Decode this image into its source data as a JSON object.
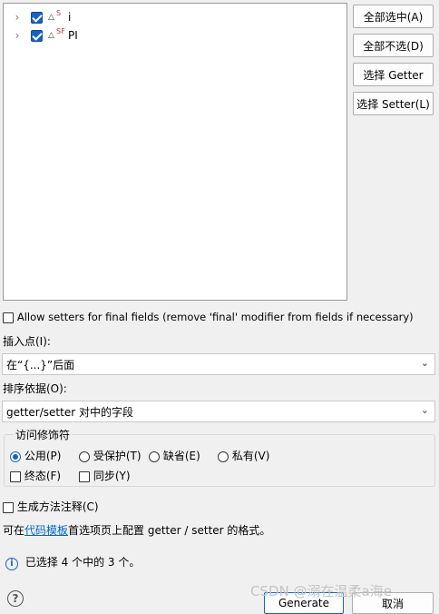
{
  "fields": [
    {
      "name": "i",
      "modifier": "S",
      "checked": true
    },
    {
      "name": "PI",
      "modifier": "SF",
      "checked": true
    }
  ],
  "buttons": {
    "select_all": "全部选中(A)",
    "deselect_all": "全部不选(D)",
    "select_getter": "选择 Getter",
    "select_setter": "选择 Setter(L)"
  },
  "allow_setters_final": "Allow setters for final fields (remove 'final' modifier from fields if necessary)",
  "insertion_point": {
    "label": "插入点(I):",
    "value": "在“{...}”后面"
  },
  "sort_order": {
    "label": "排序依据(O):",
    "value": "getter/setter 对中的字段"
  },
  "access_modifier": {
    "title": "访问修饰符",
    "options": [
      "公用(P)",
      "受保护(T)",
      "缺省(E)",
      "私有(V)"
    ],
    "selected": "公用(P)",
    "final_label": "终态(F)",
    "sync_label": "同步(Y)"
  },
  "generate_comments": "生成方法注释(C)",
  "template_hint": {
    "prefix": "可在",
    "link": "代码模板",
    "suffix": "首选项页上配置 getter / setter 的格式。"
  },
  "status": "已选择 4 个中的 3 个。",
  "footer": {
    "generate": "Generate",
    "cancel": "取消"
  },
  "watermark": "CSDN @溺在温柔a海e",
  "accent_color": "#1565c0"
}
